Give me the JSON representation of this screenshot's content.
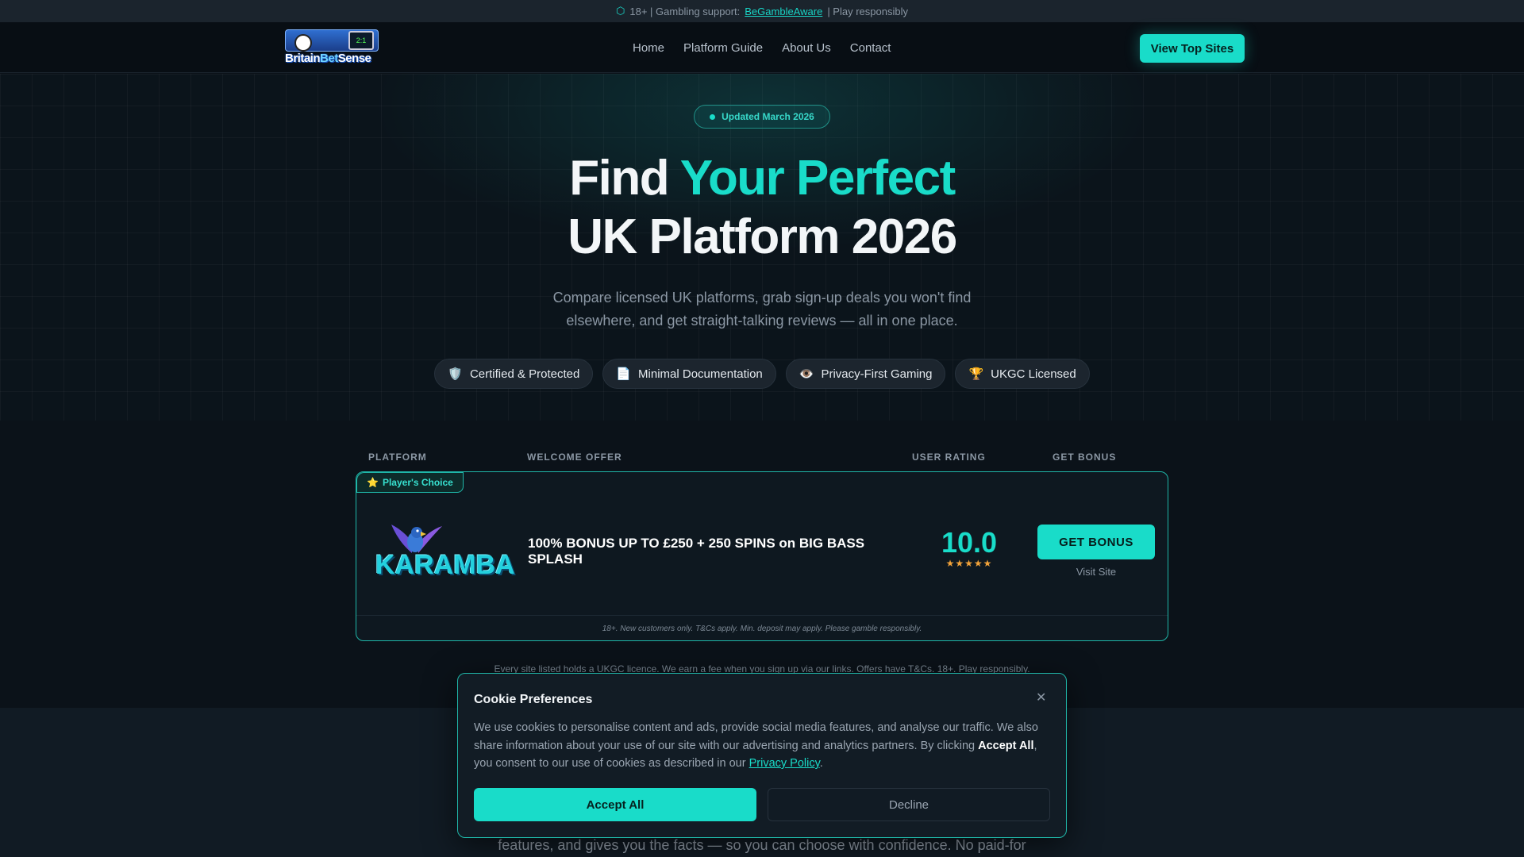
{
  "topbar": {
    "prefix": "18+ | Gambling support:",
    "link": "BeGambleAware",
    "suffix": "| Play responsibly"
  },
  "nav": {
    "logo_text_a": "Britain",
    "logo_text_b": "Bet",
    "logo_text_c": "Sense",
    "links": [
      "Home",
      "Platform Guide",
      "About Us",
      "Contact"
    ],
    "cta": "View Top Sites"
  },
  "hero": {
    "pill": "Updated March 2026",
    "headline_a": "Find ",
    "headline_accent": "Your Perfect",
    "headline_b": "UK Platform 2026",
    "subtitle": "Compare licensed UK platforms, grab sign-up deals you won't find elsewhere, and get straight-talking reviews — all in one place.",
    "badges": [
      {
        "icon": "🛡️",
        "label": "Certified & Protected"
      },
      {
        "icon": "📄",
        "label": "Minimal Documentation"
      },
      {
        "icon": "👁️",
        "label": "Privacy-First Gaming"
      },
      {
        "icon": "🏆",
        "label": "UKGC Licensed"
      }
    ]
  },
  "table": {
    "headers": [
      "PLATFORM",
      "WELCOME OFFER",
      "USER RATING",
      "GET BONUS"
    ],
    "rows": [
      {
        "tag": "Player's Choice",
        "brand": "KARAMBA",
        "offer": "100% BONUS UP TO £250 + 250 SPINS on BIG BASS SPLASH",
        "rating": "10.0",
        "stars": "★★★★★",
        "button": "GET BONUS",
        "visit": "Visit Site",
        "terms": "18+. New customers only. T&Cs apply. Min. deposit may apply. Please gamble responsibly."
      }
    ]
  },
  "disclaimer": "Every site listed holds a UKGC licence. We earn a fee when you sign up via our links. Offers have T&Cs. 18+. Play responsibly.",
  "lower_text": "features, and gives you the facts — so you can choose with confidence. No paid-for",
  "cookie": {
    "title": "Cookie Preferences",
    "body_a": "We use cookies to personalise content and ads, provide social media features, and analyse our traffic. We also share information about your use of our site with our advertising and analytics partners. By clicking ",
    "body_bold": "Accept All",
    "body_b": ", you consent to our use of cookies as described in our ",
    "body_link": "Privacy Policy",
    "body_end": ".",
    "accept": "Accept All",
    "decline": "Decline"
  },
  "colors": {
    "accent": "#19dcc9",
    "background": "#0b1219"
  }
}
